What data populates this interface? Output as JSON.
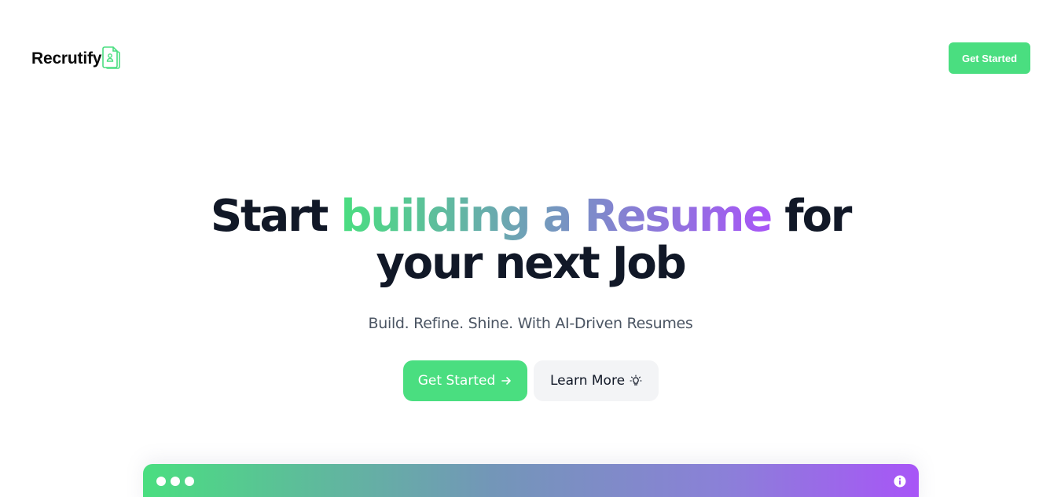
{
  "brand": {
    "name": "Recrutify",
    "icon": "resume-document-icon",
    "accent": "#4ade80",
    "gradient_end": "#a855f7"
  },
  "header": {
    "cta_label": "Get Started"
  },
  "hero": {
    "title_part1": "Start",
    "title_highlight": "building a Resume",
    "title_part2": "for",
    "title_line2": "your next Job",
    "subtitle": "Build. Refine. Shine. With AI-Driven Resumes",
    "primary_label": "Get Started",
    "primary_icon": "arrow-right-icon",
    "secondary_label": "Learn More",
    "secondary_icon": "lightbulb-icon"
  },
  "preview": {
    "window_controls": 3,
    "info_icon": "info-icon"
  }
}
